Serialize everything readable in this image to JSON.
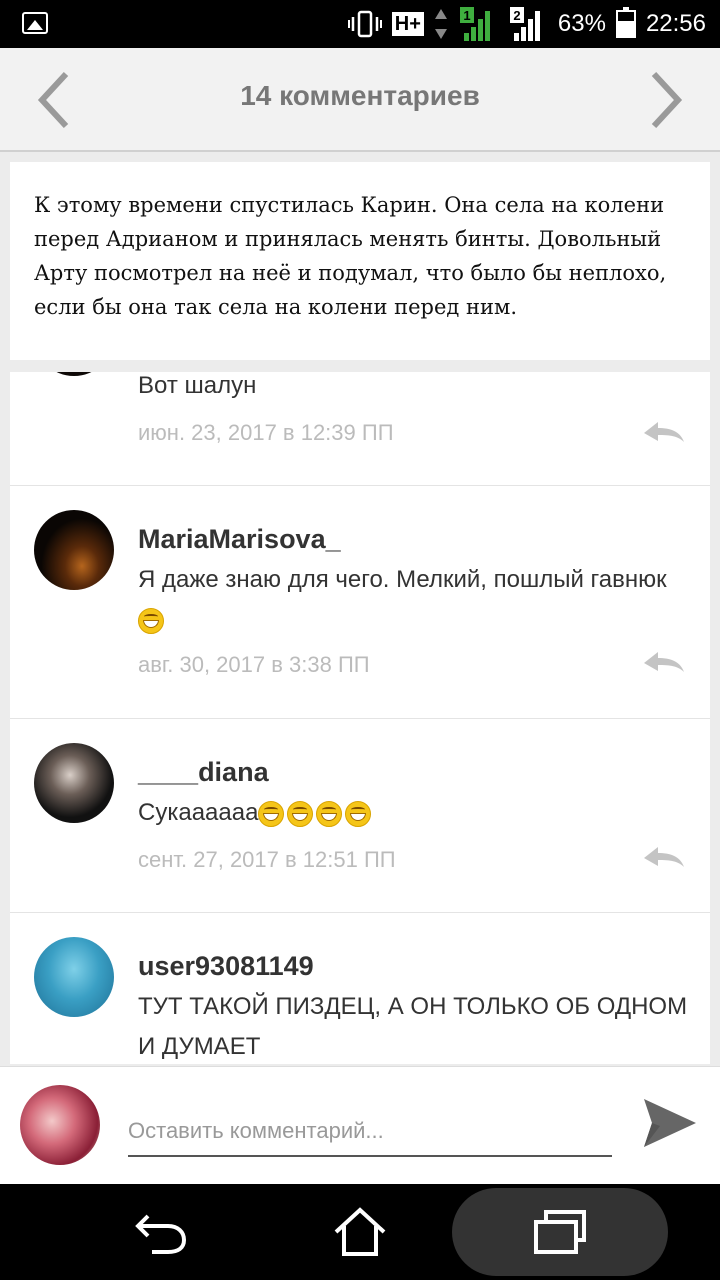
{
  "status_bar": {
    "network_badge": "H+",
    "sim1": "1",
    "sim2": "2",
    "battery_percent": "63%",
    "battery_level": 0.63,
    "time": "22:56"
  },
  "header": {
    "title": "14 комментариев",
    "prev_icon": "chevron-left-icon",
    "next_icon": "chevron-right-icon"
  },
  "excerpt": {
    "text": "К этому времени спустилась Карин. Она села на колени перед Адрианом и принялась менять бинты. Довольный Арту посмотрел на неё и подумал, что было бы неплохо, если бы она так села на колени перед ним."
  },
  "comments": [
    {
      "username": "",
      "text": "Вот шалун",
      "emoji_count": 0,
      "date": "июн. 23, 2017 в 12:39 ПП"
    },
    {
      "username": "MariaMarisova_",
      "text": "Я даже знаю для чего. Мелкий, пошлый гавнюк",
      "emoji_count": 1,
      "date": "авг. 30, 2017 в 3:38 ПП"
    },
    {
      "username": "____diana",
      "text": "Сукаааааа",
      "emoji_count": 4,
      "date": "сент. 27, 2017 в 12:51 ПП"
    },
    {
      "username": "user93081149",
      "text": "ТУТ ТАКОЙ ПИЗДЕЦ, А ОН ТОЛЬКО ОБ ОДНОМ И ДУМАЕТ",
      "emoji_count": 0,
      "date": ""
    }
  ],
  "composer": {
    "placeholder": "Оставить комментарий...",
    "value": ""
  },
  "colors": {
    "header_bg": "#f2f2f2",
    "title": "#777777",
    "date": "#bbbbbb",
    "page_bg": "#ececec"
  }
}
